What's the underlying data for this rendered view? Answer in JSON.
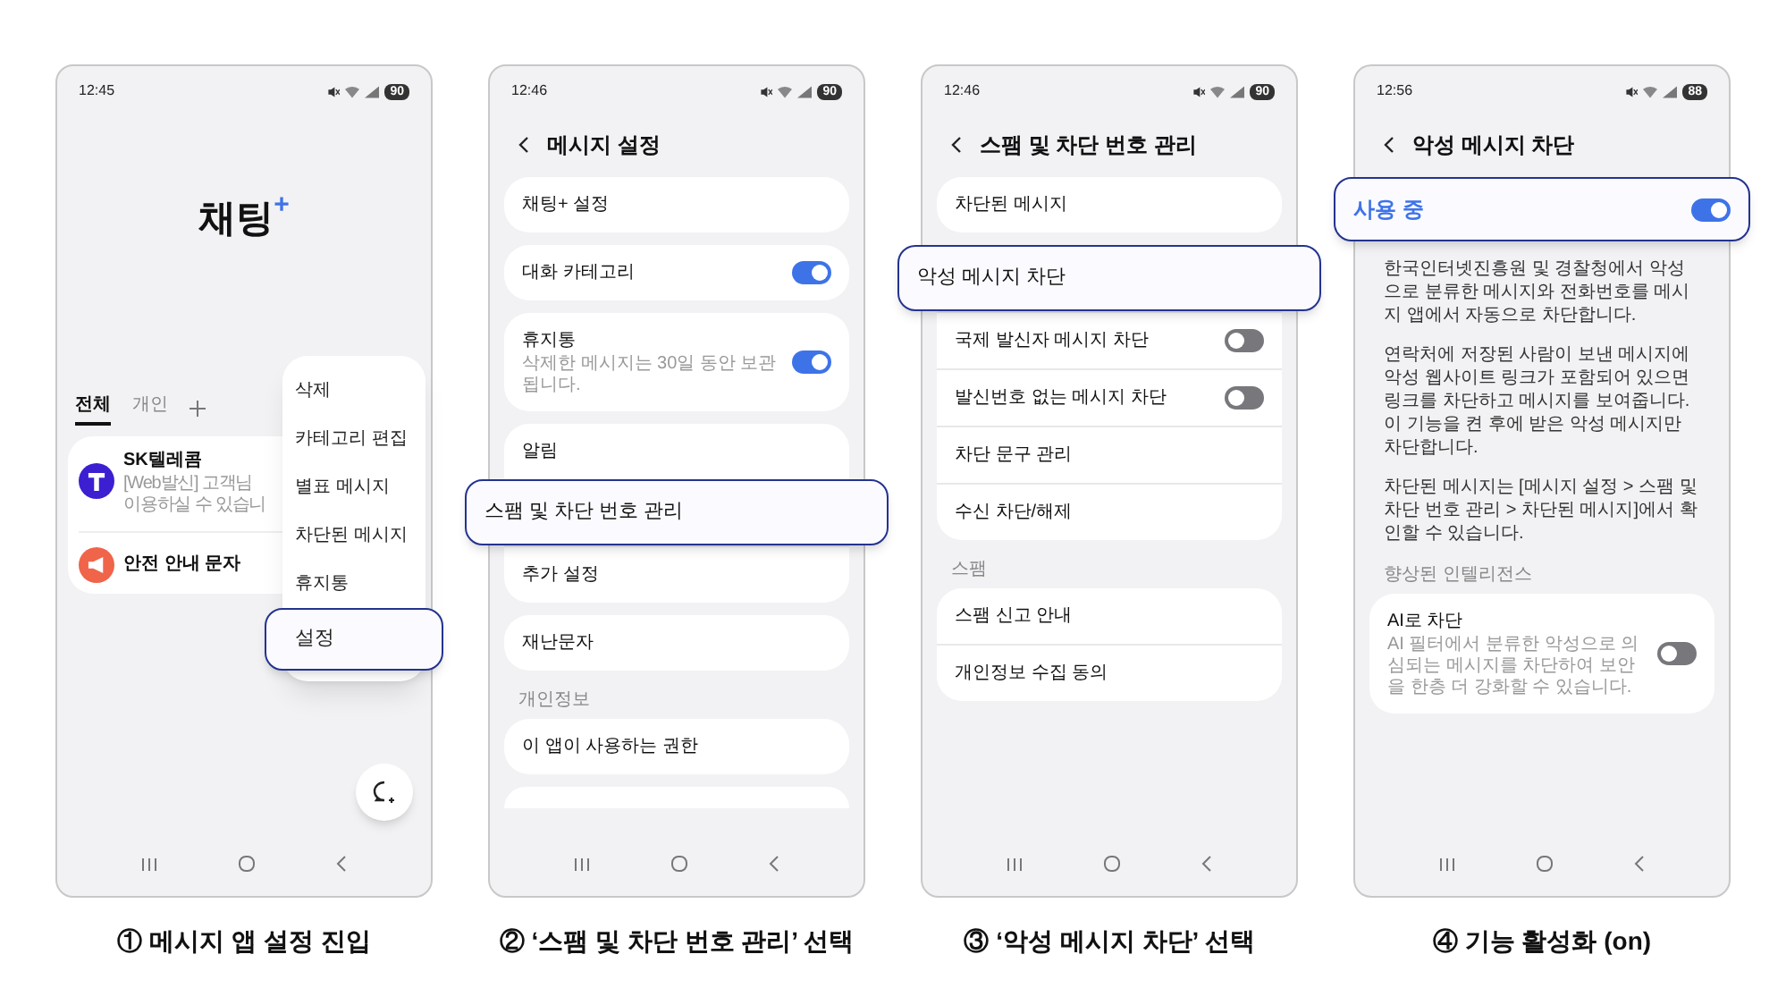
{
  "panels": [
    {
      "kind": "home",
      "status": {
        "time": "12:45",
        "battery": "90"
      },
      "logo": {
        "text": "채팅",
        "mark": "+"
      },
      "tabs": [
        {
          "label": "전체",
          "selected": true
        },
        {
          "label": "개인",
          "selected": false
        }
      ],
      "conversations": [
        {
          "name": "SK텔레콤",
          "preview": [
            "[Web발신] 고객님",
            "이용하실 수 있습니"
          ],
          "color": "#3b1fd1",
          "kind": "brand"
        },
        {
          "name": "안전 안내 문자",
          "color": "#f0644a",
          "kind": "alert"
        }
      ],
      "menu": [
        {
          "label": "삭제",
          "highlighted": false
        },
        {
          "label": "카테고리 편집",
          "highlighted": false
        },
        {
          "label": "별표 메시지",
          "highlighted": false
        },
        {
          "label": "차단된 메시지",
          "highlighted": false
        },
        {
          "label": "휴지통",
          "highlighted": false
        },
        {
          "label": "설정",
          "highlighted": true
        }
      ],
      "caption": "① 메시지 앱 설정 진입"
    },
    {
      "kind": "settings",
      "status": {
        "time": "12:46",
        "battery": "90"
      },
      "title": "메시지 설정",
      "groups": [
        {
          "items": [
            {
              "label": "채팅+ 설정",
              "highlighted": false
            }
          ]
        },
        {
          "items": [
            {
              "label": "대화 카테고리",
              "on": true,
              "highlighted": false
            }
          ]
        },
        {
          "items": [
            {
              "label": "휴지통",
              "sub": "삭제한 메시지는 30일 동안 보관됩니다.",
              "on": true,
              "highlighted": false
            }
          ]
        },
        {
          "items": [
            {
              "label": "알림",
              "highlighted": false
            },
            {
              "label": "스팸 및 차단 번호 관리",
              "highlighted": true
            },
            {
              "label": "추가 설정",
              "highlighted": false
            }
          ]
        },
        {
          "items": [
            {
              "label": "재난문자",
              "highlighted": false
            }
          ]
        },
        {
          "header": "개인정보",
          "items": [
            {
              "label": "이 앱이 사용하는 권한",
              "highlighted": false
            }
          ]
        }
      ],
      "more_below": true,
      "caption": "② ‘스팸 및 차단 번호 관리’ 선택"
    },
    {
      "kind": "settings",
      "status": {
        "time": "12:46",
        "battery": "90"
      },
      "title": "스팸 및 차단 번호 관리",
      "groups": [
        {
          "items": [
            {
              "label": "차단된 메시지",
              "highlighted": false
            }
          ]
        },
        {
          "items": [
            {
              "label": "악성 메시지 차단",
              "highlighted": true
            },
            {
              "label": "국제 발신자 메시지 차단",
              "on": false,
              "highlighted": false
            },
            {
              "label": "발신번호 없는 메시지 차단",
              "on": false,
              "highlighted": false
            },
            {
              "label": "차단 문구 관리",
              "highlighted": false
            },
            {
              "label": "수신 차단/해제",
              "highlighted": false
            }
          ]
        },
        {
          "header": "스팸",
          "items": [
            {
              "label": "스팸 신고 안내",
              "highlighted": false
            },
            {
              "label": "개인정보 수집 동의",
              "highlighted": false
            }
          ]
        }
      ],
      "caption": "③ ‘악성 메시지 차단’ 선택"
    },
    {
      "kind": "settings",
      "status": {
        "time": "12:56",
        "battery": "88"
      },
      "title": "악성 메시지 차단",
      "master": {
        "label": "사용 중",
        "on": true,
        "highlighted": true
      },
      "paragraphs": [
        "한국인터넷진흥원 및 경찰청에서 악성으로 분류한 메시지와 전화번호를 메시지 앱에서 자동으로 차단합니다.",
        "연락처에 저장된 사람이 보낸 메시지에 악성 웹사이트 링크가 포함되어 있으면 링크를 차단하고 메시지를 보여줍니다. 이 기능을 켠 후에 받은 악성 메시지만 차단합니다.",
        "차단된 메시지는 [메시지 설정 > 스팸 및 차단 번호 관리 > 차단된 메시지]에서 확인할 수 있습니다."
      ],
      "groups": [
        {
          "header": "향상된 인텔리전스",
          "items": [
            {
              "label": "AI로 차단",
              "sub": "AI 필터에서 분류한 악성으로 의심되는 메시지를 차단하여 보안을 한층 더 강화할 수 있습니다.",
              "on": false,
              "highlighted": false
            }
          ]
        }
      ],
      "caption": "④ 기능 활성화 (on)"
    }
  ]
}
